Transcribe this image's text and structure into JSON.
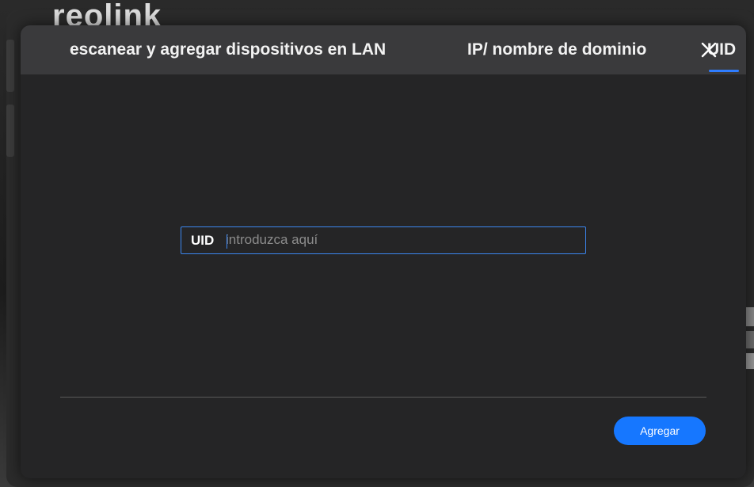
{
  "background": {
    "logo_text": "reolink"
  },
  "dialog": {
    "tabs": [
      {
        "label": "escanear y agregar dispositivos en LAN",
        "active": false
      },
      {
        "label": "IP/ nombre de dominio",
        "active": false
      },
      {
        "label": "UID",
        "active": true
      }
    ],
    "close_icon": "close-icon",
    "uid_field": {
      "label": "UID",
      "value": "",
      "placeholder": "introduzca aquí"
    },
    "add_button_label": "Agregar"
  },
  "colors": {
    "accent": "#1677ff",
    "field_border": "#3b86f0",
    "dialog_bg": "#252526",
    "tabbar_bg": "#3a3a3c"
  }
}
